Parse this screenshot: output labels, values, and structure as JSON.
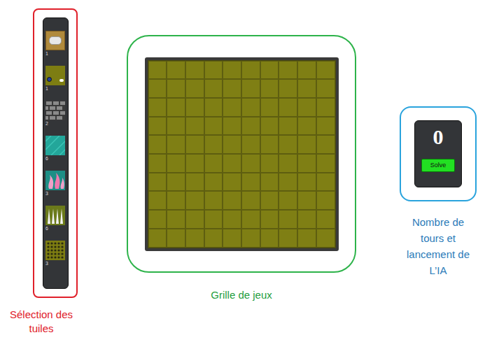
{
  "tile_selector": {
    "label": "Sélection des tuiles",
    "tiles": [
      {
        "kind": "rock",
        "count": "1"
      },
      {
        "kind": "start",
        "count": "1"
      },
      {
        "kind": "wall",
        "count": "2"
      },
      {
        "kind": "water",
        "count": "6"
      },
      {
        "kind": "fire",
        "count": "3"
      },
      {
        "kind": "spikes",
        "count": "6"
      },
      {
        "kind": "holes",
        "count": "3"
      }
    ]
  },
  "board": {
    "label": "Grille de jeux",
    "rows": 10,
    "columns": 10
  },
  "control": {
    "turns": "0",
    "button": "Solve",
    "label": "Nombre de tours et lancement de L’IA"
  }
}
